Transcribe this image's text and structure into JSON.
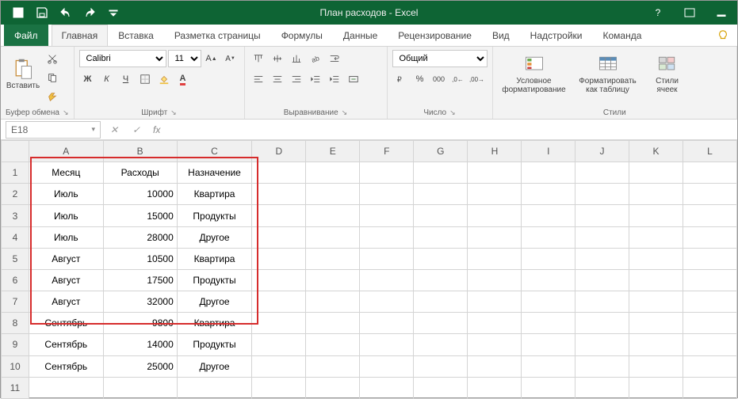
{
  "window": {
    "title": "План расходов - Excel"
  },
  "tabs": [
    "Файл",
    "Главная",
    "Вставка",
    "Разметка страницы",
    "Формулы",
    "Данные",
    "Рецензирование",
    "Вид",
    "Надстройки",
    "Команда"
  ],
  "active_tab": 1,
  "ribbon": {
    "clipboard": {
      "paste": "Вставить",
      "label": "Буфер обмена"
    },
    "font": {
      "name": "Calibri",
      "size": "11",
      "bold": "Ж",
      "italic": "К",
      "underline": "Ч",
      "label": "Шрифт"
    },
    "alignment": {
      "label": "Выравнивание"
    },
    "number": {
      "format": "Общий",
      "label": "Число"
    },
    "styles": {
      "cond": "Условное форматирование",
      "table": "Форматировать как таблицу",
      "cell": "Стили ячеек",
      "label": "Стили"
    }
  },
  "namebox": {
    "ref": "E18"
  },
  "formula": {
    "value": ""
  },
  "columns": [
    "A",
    "B",
    "C",
    "D",
    "E",
    "F",
    "G",
    "H",
    "I",
    "J",
    "K",
    "L"
  ],
  "rows": {
    "1": {
      "A": "Месяц",
      "B": "Расходы",
      "C": "Назначение"
    },
    "2": {
      "A": "Июль",
      "B": "10000",
      "C": "Квартира"
    },
    "3": {
      "A": "Июль",
      "B": "15000",
      "C": "Продукты"
    },
    "4": {
      "A": "Июль",
      "B": "28000",
      "C": "Другое"
    },
    "5": {
      "A": "Август",
      "B": "10500",
      "C": "Квартира"
    },
    "6": {
      "A": "Август",
      "B": "17500",
      "C": "Продукты"
    },
    "7": {
      "A": "Август",
      "B": "32000",
      "C": "Другое"
    },
    "8": {
      "A": "Сентябрь",
      "B": "9800",
      "C": "Квартира"
    },
    "9": {
      "A": "Сентябрь",
      "B": "14000",
      "C": "Продукты"
    },
    "10": {
      "A": "Сентябрь",
      "B": "25000",
      "C": "Другое"
    }
  },
  "row_count": 11,
  "highlight": {
    "top": 0,
    "left": 0,
    "rows": 10,
    "cols": 3
  }
}
